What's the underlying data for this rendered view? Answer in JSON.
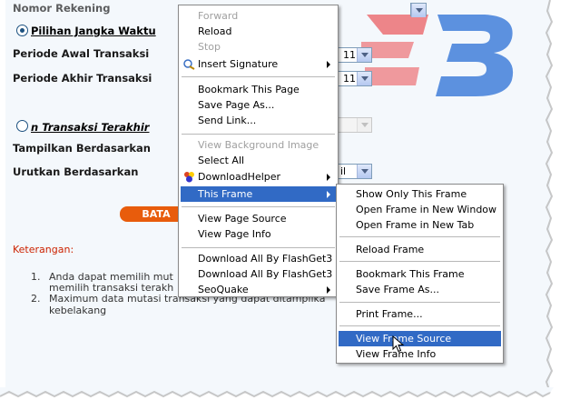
{
  "form": {
    "account_label": "Nomor Rekening",
    "period_option_label": "Pilihan Jangka Waktu",
    "start_label": "Periode Awal Transaksi",
    "end_label": "Periode Akhir Transaksi",
    "start_value": "11",
    "end_value": "11",
    "last_n_label": "n Transaksi Terakhir",
    "display_label": "Tampilkan Berdasarkan",
    "sort_label": "Urutkan Berdasarkan",
    "sort_value": "il",
    "cancel_button": "BATA",
    "notes_title": "Keterangan:",
    "notes": [
      {
        "num": "1.",
        "line1": "Anda dapat memilih mut",
        "line2": "memilih transaksi terakh"
      },
      {
        "num": "2.",
        "line1": "Maximum data mutasi transaksi yang dapat ditampilka",
        "line2": "kebelakang"
      }
    ]
  },
  "context_menu": {
    "items": [
      {
        "label": "Forward",
        "disabled": true
      },
      {
        "label": "Reload"
      },
      {
        "label": "Stop",
        "disabled": true
      },
      {
        "label": "Insert Signature",
        "submenu": true,
        "icon": "signature-icon"
      },
      {
        "label": "Bookmark This Page"
      },
      {
        "label": "Save Page As..."
      },
      {
        "label": "Send Link..."
      },
      {
        "label": "View Background Image",
        "disabled": true
      },
      {
        "label": "Select All"
      },
      {
        "label": "DownloadHelper",
        "submenu": true,
        "icon": "downloadhelper-icon"
      },
      {
        "label": "This Frame",
        "submenu": true,
        "highlighted": true
      },
      {
        "label": "View Page Source"
      },
      {
        "label": "View Page Info"
      },
      {
        "label": "Download All By FlashGet3"
      },
      {
        "label": "Download All By FlashGet3"
      },
      {
        "label": "SeoQuake",
        "submenu": true
      }
    ]
  },
  "submenu": {
    "items": [
      {
        "label": "Show Only This Frame"
      },
      {
        "label": "Open Frame in New Window"
      },
      {
        "label": "Open Frame in New Tab"
      },
      {
        "label": "Reload Frame"
      },
      {
        "label": "Bookmark This Frame"
      },
      {
        "label": "Save Frame As..."
      },
      {
        "label": "Print Frame..."
      },
      {
        "label": "View Frame Source",
        "highlighted": true
      },
      {
        "label": "View Frame Info"
      }
    ]
  },
  "colors": {
    "accent": "#316ac5",
    "button": "#e85c0c",
    "logo_red": "#e8262a",
    "logo_blue": "#2a6fd6"
  }
}
